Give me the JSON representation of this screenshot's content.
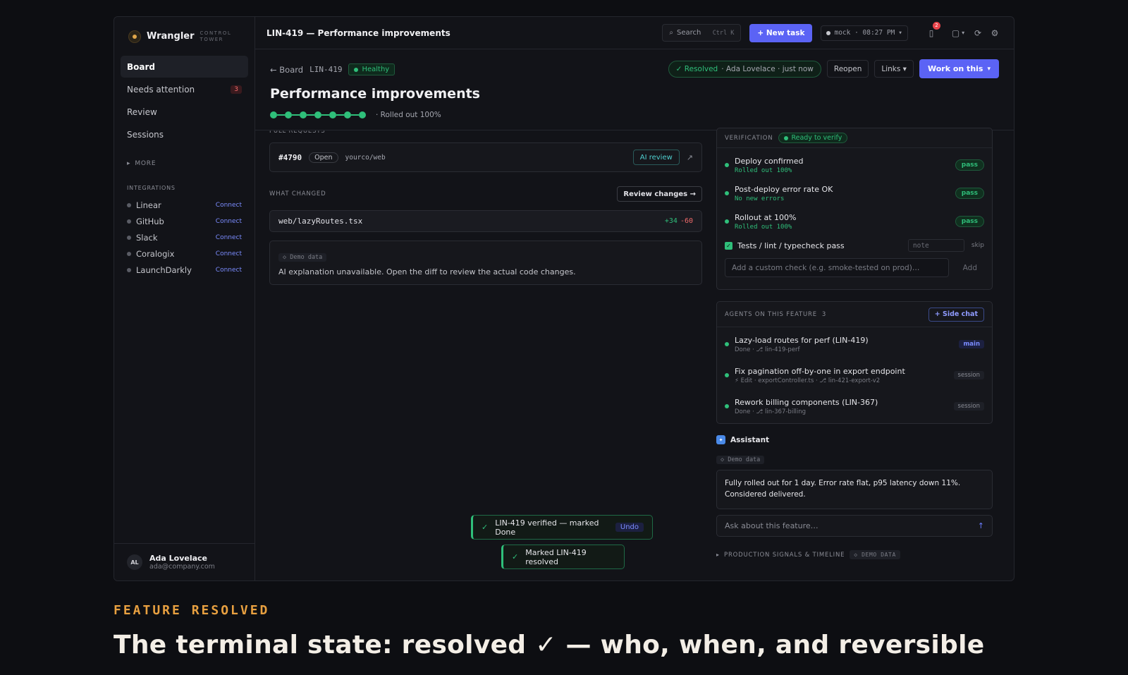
{
  "brand": {
    "name": "Wrangler",
    "sub": "CONTROL TOWER"
  },
  "sidebar": {
    "items": [
      {
        "label": "Board"
      },
      {
        "label": "Needs attention",
        "badge": "3"
      },
      {
        "label": "Review"
      },
      {
        "label": "Sessions"
      }
    ],
    "more": "MORE",
    "integrations_label": "INTEGRATIONS",
    "integrations": [
      {
        "name": "Linear",
        "action": "Connect"
      },
      {
        "name": "GitHub",
        "action": "Connect"
      },
      {
        "name": "Slack",
        "action": "Connect"
      },
      {
        "name": "Coralogix",
        "action": "Connect"
      },
      {
        "name": "LaunchDarkly",
        "action": "Connect"
      }
    ],
    "user": {
      "initials": "AL",
      "name": "Ada Lovelace",
      "email": "ada@company.com"
    }
  },
  "topbar": {
    "title": "LIN-419 — Performance improvements",
    "search": "Search",
    "search_kbd": "Ctrl K",
    "new_task": "+ New task",
    "mock": "mock · 08:27 PM",
    "notif_count": "2"
  },
  "header": {
    "back": "← Board",
    "issue_id": "LIN-419",
    "health": "Healthy",
    "resolved": "✓ Resolved",
    "resolved_by": "· Ada Lovelace · just now",
    "reopen": "Reopen",
    "links": "Links ▾",
    "work_on_this": "Work on this",
    "title": "Performance improvements",
    "progress_steps": 7,
    "progress_completed": 7,
    "progress_label": "· Rolled out 100%"
  },
  "pull_requests": {
    "label": "PULL REQUESTS",
    "number": "#4790",
    "status": "Open",
    "repo": "yourco/web",
    "ai_review": "AI review"
  },
  "what_changed": {
    "label": "WHAT CHANGED",
    "review_button": "Review changes →",
    "file": "web/lazyRoutes.tsx",
    "additions": "+34",
    "deletions": "-60",
    "demo_chip": "◇ Demo data",
    "explanation": "AI explanation unavailable. Open the diff to review the actual code changes."
  },
  "verification": {
    "label": "VERIFICATION",
    "status": "Ready to verify",
    "checks": [
      {
        "title": "Deploy confirmed",
        "sub": "Rolled out 100%",
        "result": "pass"
      },
      {
        "title": "Post-deploy error rate OK",
        "sub": "No new errors",
        "result": "pass"
      },
      {
        "title": "Rollout at 100%",
        "sub": "Rolled out 100%",
        "result": "pass"
      }
    ],
    "manual_check": "Tests / lint / typecheck pass",
    "note_placeholder": "note",
    "skip": "skip",
    "custom_placeholder": "Add a custom check (e.g. smoke-tested on prod)…",
    "add": "Add"
  },
  "agents": {
    "label": "AGENTS ON THIS FEATURE",
    "count": "3",
    "side_chat": "+ Side chat",
    "list": [
      {
        "title": "Lazy-load routes for perf (LIN-419)",
        "sub": "Done · ⎇ lin-419-perf",
        "tag": "main"
      },
      {
        "title": "Fix pagination off-by-one in export endpoint",
        "sub": "⚡ Edit · exportController.ts · ⎇ lin-421-export-v2",
        "tag": "session"
      },
      {
        "title": "Rework billing components (LIN-367)",
        "sub": "Done · ⎇ lin-367-billing",
        "tag": "session"
      }
    ]
  },
  "assistant": {
    "label": "Assistant",
    "demo_chip": "◇ Demo data",
    "message": "Fully rolled out for 1 day. Error rate flat, p95 latency down 11%. Considered delivered.",
    "ask_placeholder": "Ask about this feature…"
  },
  "signals": {
    "label": "PRODUCTION SIGNALS & TIMELINE",
    "demo": "◇ DEMO DATA"
  },
  "toasts": [
    {
      "text": "LIN-419 verified — marked Done",
      "action": "Undo"
    },
    {
      "text": "Marked LIN-419 resolved"
    }
  ],
  "caption": {
    "kicker": "FEATURE RESOLVED",
    "title": "The terminal state: resolved ✓ — who, when, and reversible"
  },
  "colors": {
    "accent": "#5b63f5",
    "success": "#2fbf7a",
    "danger": "#f06a6a",
    "kicker": "#e8a040"
  }
}
